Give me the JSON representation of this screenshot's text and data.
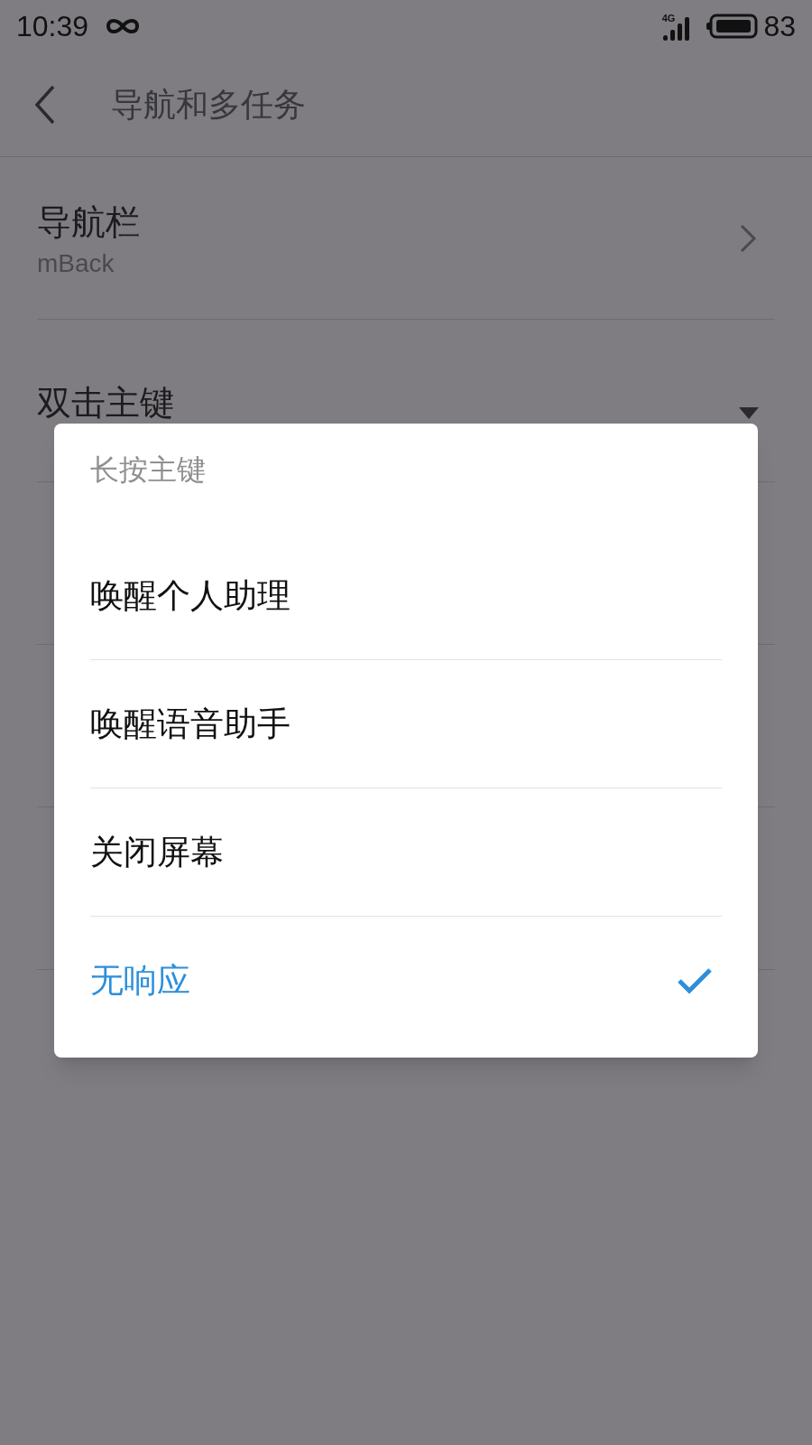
{
  "status_bar": {
    "time": "10:39",
    "network": "4G",
    "battery": "83"
  },
  "header": {
    "title": "导航和多任务"
  },
  "settings": [
    {
      "kind": "link",
      "title": "导航栏",
      "subtitle": "mBack"
    },
    {
      "kind": "dropdown",
      "title": "双击主键"
    }
  ],
  "dialog": {
    "title": "长按主键",
    "options": [
      {
        "label": "唤醒个人助理",
        "selected": false
      },
      {
        "label": "唤醒语音助手",
        "selected": false
      },
      {
        "label": "关闭屏幕",
        "selected": false
      },
      {
        "label": "无响应",
        "selected": true
      }
    ]
  }
}
